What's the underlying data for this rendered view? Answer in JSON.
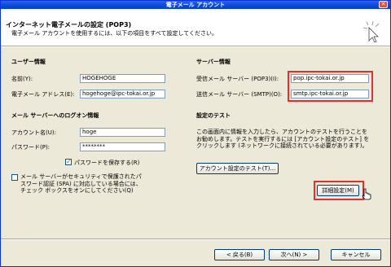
{
  "window": {
    "title": "電子メール アカウント",
    "close_glyph": "✕"
  },
  "header": {
    "title": "インターネット電子メールの設定 (POP3)",
    "subtitle": "電子メール アカウントを使用するには、以下の項目をすべて設定してください。"
  },
  "user_info": {
    "heading": "ユーザー情報",
    "name_label": "名前(Y):",
    "name_value": "HOGEHOGE",
    "email_label": "電子メール アドレス(E):",
    "email_value": "hogehoge@ipc-tokai.or.jp"
  },
  "server_info": {
    "heading": "サーバー情報",
    "incoming_label": "受信メール サーバー (POP3)(I):",
    "incoming_value": "pop.ipc-tokai.or.jp",
    "outgoing_label": "送信メール サーバー (SMTP)(O):",
    "outgoing_value": "smtp.ipc-tokai.or.jp"
  },
  "logon": {
    "heading": "メール サーバーへのログオン情報",
    "account_label": "アカウント名(U):",
    "account_value": "hoge",
    "password_label": "パスワード(P):",
    "password_value": "********",
    "save_password_label": "パスワードを保存する(R)",
    "save_password_checked": true,
    "spa_text": "メール サーバーがセキュリティで保護されたパスワード認証 (SPA) に対応している場合には、チェック ボックスをオンにしてください(Q)",
    "spa_checked": false
  },
  "test": {
    "heading": "設定のテスト",
    "description": "この画面内に情報を入力したら、アカウントのテストを行うことをお勧めします。テストを実行するには [アカウント設定のテスト] をクリックします (ネットワークに接続されている必要があります)。",
    "test_button": "アカウント設定のテスト(T)...",
    "advanced_button": "詳細設定(M)"
  },
  "footer": {
    "back_button": "< 戻る(B)",
    "next_button": "次へ(N) >",
    "cancel_button": "キャンセル"
  },
  "colors": {
    "highlight": "#e03030",
    "title_bar": "#0a49d6",
    "dialog_bg": "#ece9d8"
  }
}
